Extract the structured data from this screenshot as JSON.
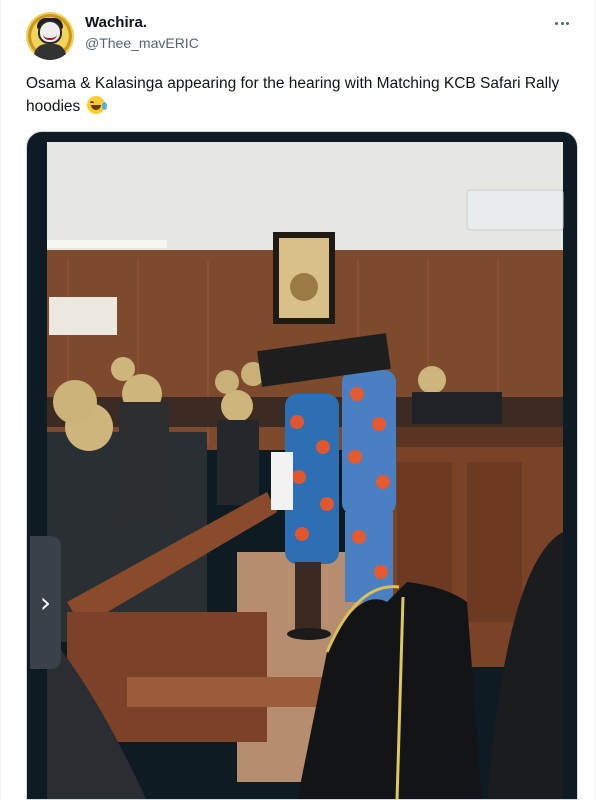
{
  "tweet": {
    "author": {
      "display_name": "Wachira.",
      "handle": "@Thee_mavERIC"
    },
    "text": "Osama & Kalasinga appearing for the hearing with Matching KCB Safari Rally hoodies",
    "emoji": "face-with-tears-of-joy",
    "more_icon": "more-horizontal-icon",
    "media": {
      "description_icon": "photo",
      "nav_arrow": "›"
    }
  },
  "colors": {
    "text": "#0f1419",
    "secondary": "#536471",
    "media_frame": "#0f1b22"
  }
}
